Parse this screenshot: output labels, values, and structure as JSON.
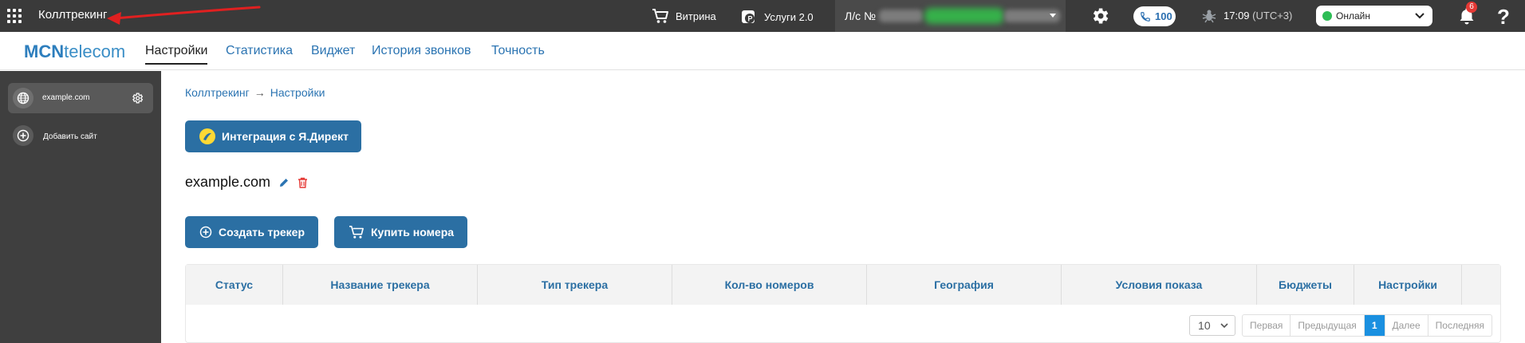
{
  "topbar": {
    "app_title": "Коллтрекинг",
    "links": [
      {
        "label": "Витрина",
        "icon": "cart-icon"
      },
      {
        "label": "Услуги 2.0",
        "icon": "services-icon"
      }
    ],
    "account_label": "Л/с №",
    "calls_count": "100",
    "time": "17:09",
    "timezone": "(UTC+3)",
    "status": "Онлайн",
    "notifications_count": "6",
    "help_label": "?"
  },
  "nav": {
    "logo_bold": "MCN",
    "logo_rest": "telecom",
    "items": [
      "Настройки",
      "Статистика",
      "Виджет",
      "История звонков",
      "Точность"
    ]
  },
  "sidebar": {
    "site_name": "example.com",
    "add_site": "Добавить сайт"
  },
  "main": {
    "breadcrumb": [
      "Коллтрекинг",
      "Настройки"
    ],
    "breadcrumb_sep": "→",
    "direct_button": "Интеграция с Я.Директ",
    "site_title": "example.com",
    "create_tracker": "Создать трекер",
    "buy_numbers": "Купить номера"
  },
  "table": {
    "columns": [
      "Статус",
      "Название трекера",
      "Тип трекера",
      "Кол-во номеров",
      "География",
      "Условия показа",
      "Бюджеты",
      "Настройки"
    ],
    "page_size": "10",
    "pager": [
      "Первая",
      "Предыдущая",
      "1",
      "Далее",
      "Последняя"
    ]
  },
  "colors": {
    "topbar_bg": "#3a3a3a",
    "accent": "#2b6fa3",
    "link": "#2b74b2",
    "online": "#2dbd55",
    "badge": "#e53935"
  }
}
